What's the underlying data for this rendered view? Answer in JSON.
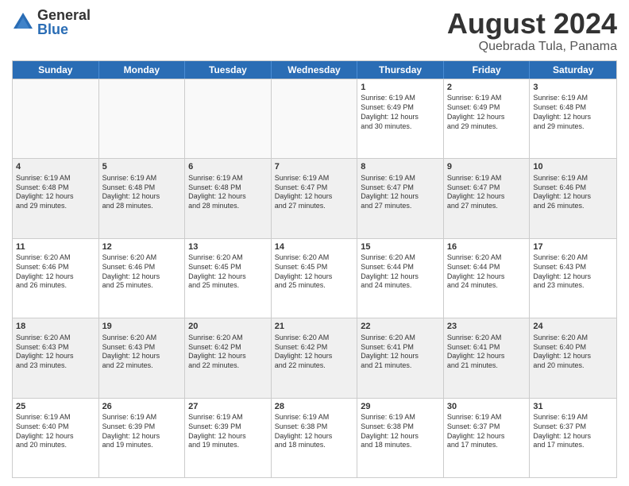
{
  "header": {
    "logo_general": "General",
    "logo_blue": "Blue",
    "title": "August 2024",
    "subtitle": "Quebrada Tula, Panama"
  },
  "days": [
    "Sunday",
    "Monday",
    "Tuesday",
    "Wednesday",
    "Thursday",
    "Friday",
    "Saturday"
  ],
  "weeks": [
    [
      {
        "day": "",
        "info": ""
      },
      {
        "day": "",
        "info": ""
      },
      {
        "day": "",
        "info": ""
      },
      {
        "day": "",
        "info": ""
      },
      {
        "day": "1",
        "info": "Sunrise: 6:19 AM\nSunset: 6:49 PM\nDaylight: 12 hours\nand 30 minutes."
      },
      {
        "day": "2",
        "info": "Sunrise: 6:19 AM\nSunset: 6:49 PM\nDaylight: 12 hours\nand 29 minutes."
      },
      {
        "day": "3",
        "info": "Sunrise: 6:19 AM\nSunset: 6:48 PM\nDaylight: 12 hours\nand 29 minutes."
      }
    ],
    [
      {
        "day": "4",
        "info": "Sunrise: 6:19 AM\nSunset: 6:48 PM\nDaylight: 12 hours\nand 29 minutes."
      },
      {
        "day": "5",
        "info": "Sunrise: 6:19 AM\nSunset: 6:48 PM\nDaylight: 12 hours\nand 28 minutes."
      },
      {
        "day": "6",
        "info": "Sunrise: 6:19 AM\nSunset: 6:48 PM\nDaylight: 12 hours\nand 28 minutes."
      },
      {
        "day": "7",
        "info": "Sunrise: 6:19 AM\nSunset: 6:47 PM\nDaylight: 12 hours\nand 27 minutes."
      },
      {
        "day": "8",
        "info": "Sunrise: 6:19 AM\nSunset: 6:47 PM\nDaylight: 12 hours\nand 27 minutes."
      },
      {
        "day": "9",
        "info": "Sunrise: 6:19 AM\nSunset: 6:47 PM\nDaylight: 12 hours\nand 27 minutes."
      },
      {
        "day": "10",
        "info": "Sunrise: 6:19 AM\nSunset: 6:46 PM\nDaylight: 12 hours\nand 26 minutes."
      }
    ],
    [
      {
        "day": "11",
        "info": "Sunrise: 6:20 AM\nSunset: 6:46 PM\nDaylight: 12 hours\nand 26 minutes."
      },
      {
        "day": "12",
        "info": "Sunrise: 6:20 AM\nSunset: 6:46 PM\nDaylight: 12 hours\nand 25 minutes."
      },
      {
        "day": "13",
        "info": "Sunrise: 6:20 AM\nSunset: 6:45 PM\nDaylight: 12 hours\nand 25 minutes."
      },
      {
        "day": "14",
        "info": "Sunrise: 6:20 AM\nSunset: 6:45 PM\nDaylight: 12 hours\nand 25 minutes."
      },
      {
        "day": "15",
        "info": "Sunrise: 6:20 AM\nSunset: 6:44 PM\nDaylight: 12 hours\nand 24 minutes."
      },
      {
        "day": "16",
        "info": "Sunrise: 6:20 AM\nSunset: 6:44 PM\nDaylight: 12 hours\nand 24 minutes."
      },
      {
        "day": "17",
        "info": "Sunrise: 6:20 AM\nSunset: 6:43 PM\nDaylight: 12 hours\nand 23 minutes."
      }
    ],
    [
      {
        "day": "18",
        "info": "Sunrise: 6:20 AM\nSunset: 6:43 PM\nDaylight: 12 hours\nand 23 minutes."
      },
      {
        "day": "19",
        "info": "Sunrise: 6:20 AM\nSunset: 6:43 PM\nDaylight: 12 hours\nand 22 minutes."
      },
      {
        "day": "20",
        "info": "Sunrise: 6:20 AM\nSunset: 6:42 PM\nDaylight: 12 hours\nand 22 minutes."
      },
      {
        "day": "21",
        "info": "Sunrise: 6:20 AM\nSunset: 6:42 PM\nDaylight: 12 hours\nand 22 minutes."
      },
      {
        "day": "22",
        "info": "Sunrise: 6:20 AM\nSunset: 6:41 PM\nDaylight: 12 hours\nand 21 minutes."
      },
      {
        "day": "23",
        "info": "Sunrise: 6:20 AM\nSunset: 6:41 PM\nDaylight: 12 hours\nand 21 minutes."
      },
      {
        "day": "24",
        "info": "Sunrise: 6:20 AM\nSunset: 6:40 PM\nDaylight: 12 hours\nand 20 minutes."
      }
    ],
    [
      {
        "day": "25",
        "info": "Sunrise: 6:19 AM\nSunset: 6:40 PM\nDaylight: 12 hours\nand 20 minutes."
      },
      {
        "day": "26",
        "info": "Sunrise: 6:19 AM\nSunset: 6:39 PM\nDaylight: 12 hours\nand 19 minutes."
      },
      {
        "day": "27",
        "info": "Sunrise: 6:19 AM\nSunset: 6:39 PM\nDaylight: 12 hours\nand 19 minutes."
      },
      {
        "day": "28",
        "info": "Sunrise: 6:19 AM\nSunset: 6:38 PM\nDaylight: 12 hours\nand 18 minutes."
      },
      {
        "day": "29",
        "info": "Sunrise: 6:19 AM\nSunset: 6:38 PM\nDaylight: 12 hours\nand 18 minutes."
      },
      {
        "day": "30",
        "info": "Sunrise: 6:19 AM\nSunset: 6:37 PM\nDaylight: 12 hours\nand 17 minutes."
      },
      {
        "day": "31",
        "info": "Sunrise: 6:19 AM\nSunset: 6:37 PM\nDaylight: 12 hours\nand 17 minutes."
      }
    ]
  ]
}
